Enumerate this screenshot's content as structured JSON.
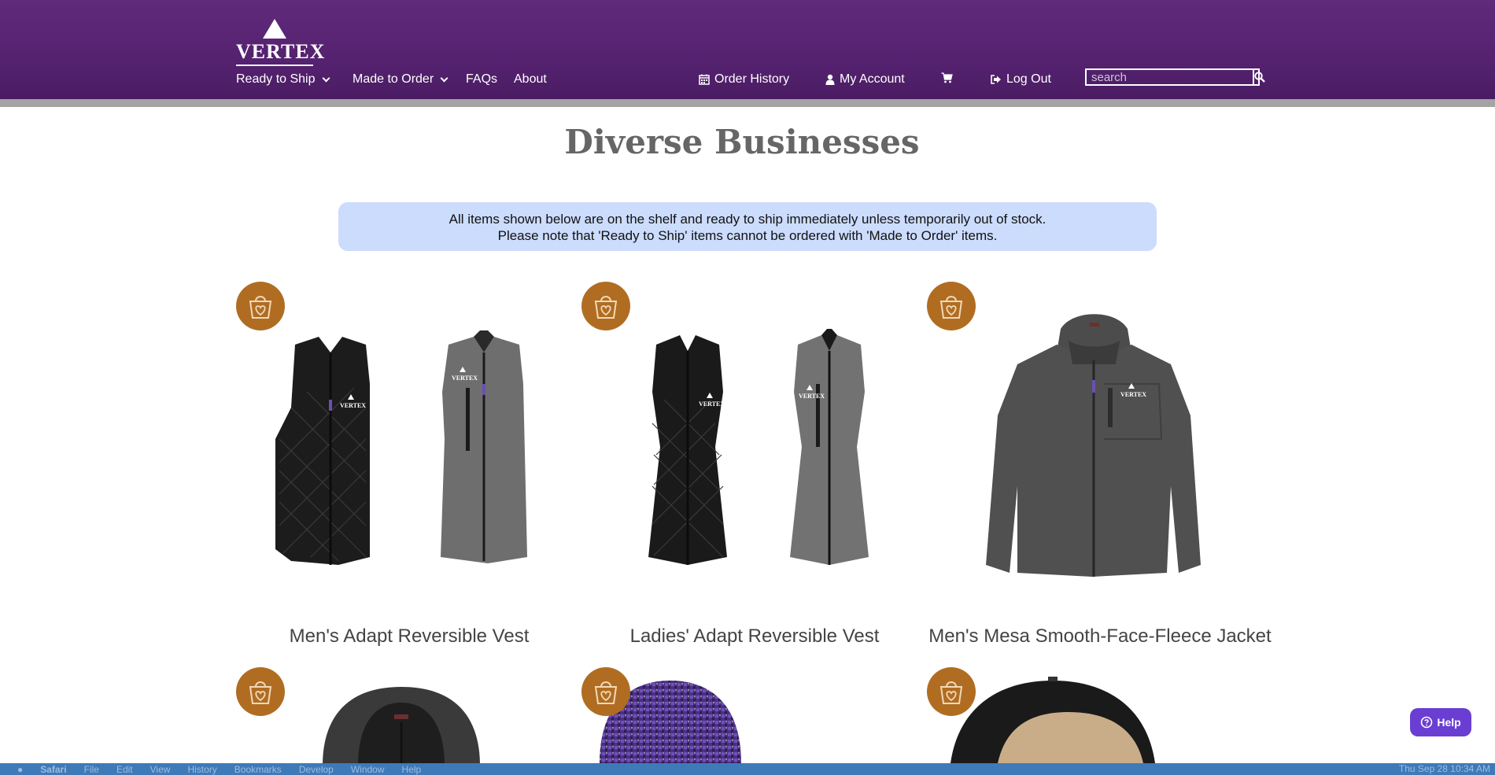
{
  "brand": {
    "logo_text": "VERTEX"
  },
  "nav": {
    "left": [
      {
        "label": "Ready to Ship"
      },
      {
        "label": "Made to Order"
      },
      {
        "label": "FAQs"
      },
      {
        "label": "About"
      }
    ],
    "right": {
      "order_history": "Order History",
      "my_account": "My Account",
      "log_out": "Log Out"
    },
    "search": {
      "placeholder": "search",
      "value": ""
    }
  },
  "page": {
    "title": "Diverse Businesses",
    "notice_line1": "All items shown below are on the shelf and ready to ship immediately unless temporarily out of stock.",
    "notice_line2": "Please note that 'Ready to Ship' items cannot be ordered with 'Made to Order' items."
  },
  "products": [
    {
      "name": "Men's Adapt Reversible Vest"
    },
    {
      "name": "Ladies' Adapt Reversible Vest"
    },
    {
      "name": "Men's Mesa Smooth-Face-Fleece Jacket"
    },
    {
      "name": ""
    },
    {
      "name": ""
    },
    {
      "name": ""
    }
  ],
  "help": {
    "label": "Help"
  },
  "os_menubar": {
    "items": [
      "Safari",
      "File",
      "Edit",
      "View",
      "History",
      "Bookmarks",
      "Develop",
      "Window",
      "Help"
    ],
    "clock": "Thu Sep 28  10:34 AM"
  },
  "colors": {
    "header": "#5a2675",
    "badge": "#b06d22",
    "notice": "#ccdcfc",
    "help": "#6a3ed2"
  }
}
